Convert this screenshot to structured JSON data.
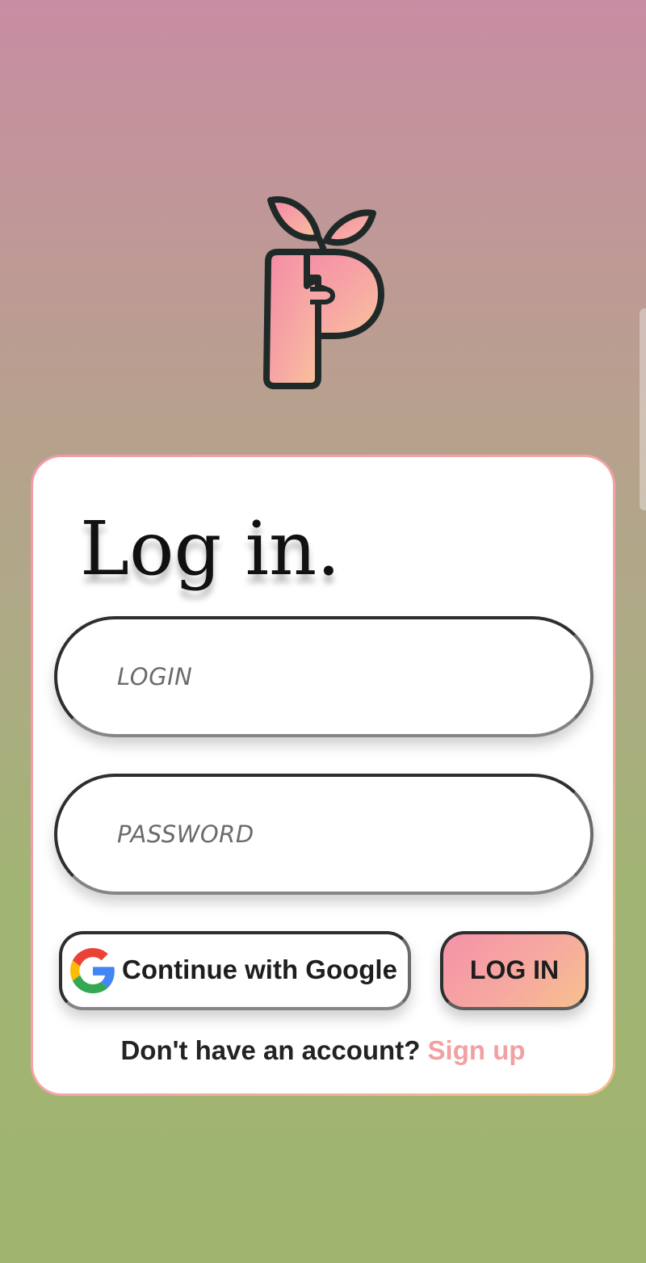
{
  "colors": {
    "accent_pink": "#f592a8",
    "accent_peach": "#f7c08e",
    "signup_link": "#f2a0a2",
    "outline_dark": "#2b2f30"
  },
  "icons": {
    "logo": "leaf-p-logo-icon",
    "google": "google-g-icon"
  },
  "login_card": {
    "title": "Log in.",
    "login_field": {
      "value": "",
      "placeholder": "LOGIN"
    },
    "password_field": {
      "value": "",
      "placeholder": "PASSWORD"
    },
    "google_button_label": "Continue with Google",
    "login_button_label": "LOG IN",
    "signup_prompt": "Don't have an account?",
    "signup_link_label": "Sign up"
  }
}
